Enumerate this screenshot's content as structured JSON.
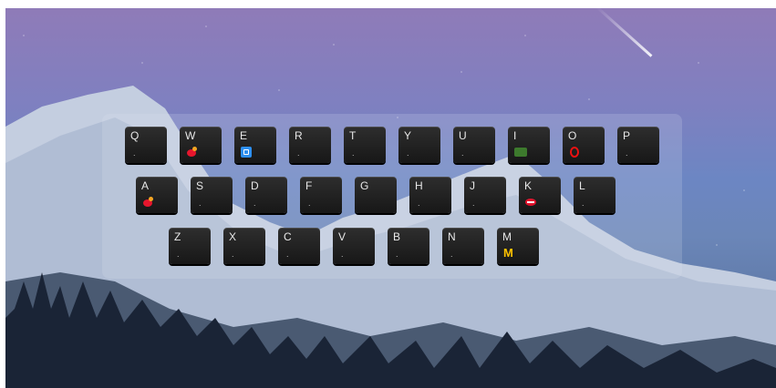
{
  "keyboard": {
    "rows": [
      [
        {
          "letter": "Q",
          "dot": ".",
          "icon": ""
        },
        {
          "letter": "W",
          "dot": "",
          "icon": "weibo-icon"
        },
        {
          "letter": "E",
          "dot": "",
          "icon": "blue-app-icon"
        },
        {
          "letter": "R",
          "dot": ".",
          "icon": ""
        },
        {
          "letter": "T",
          "dot": ".",
          "icon": ""
        },
        {
          "letter": "Y",
          "dot": ".",
          "icon": ""
        },
        {
          "letter": "U",
          "dot": ".",
          "icon": ""
        },
        {
          "letter": "I",
          "dot": "",
          "icon": "iqiyi-icon"
        },
        {
          "letter": "O",
          "dot": "",
          "icon": "opera-icon"
        },
        {
          "letter": "P",
          "dot": ".",
          "icon": ""
        }
      ],
      [
        {
          "letter": "A",
          "dot": "",
          "icon": "weibo-icon"
        },
        {
          "letter": "S",
          "dot": ".",
          "icon": ""
        },
        {
          "letter": "D",
          "dot": ".",
          "icon": ""
        },
        {
          "letter": "F",
          "dot": ".",
          "icon": ""
        },
        {
          "letter": "G",
          "dot": "",
          "icon": ""
        },
        {
          "letter": "H",
          "dot": ".",
          "icon": ""
        },
        {
          "letter": "J",
          "dot": ".",
          "icon": ""
        },
        {
          "letter": "K",
          "dot": "",
          "icon": "lips-icon"
        },
        {
          "letter": "L",
          "dot": ".",
          "icon": ""
        }
      ],
      [
        {
          "letter": "Z",
          "dot": ".",
          "icon": ""
        },
        {
          "letter": "X",
          "dot": ".",
          "icon": ""
        },
        {
          "letter": "C",
          "dot": ".",
          "icon": ""
        },
        {
          "letter": "V",
          "dot": ".",
          "icon": ""
        },
        {
          "letter": "B",
          "dot": ".",
          "icon": ""
        },
        {
          "letter": "N",
          "dot": ".",
          "icon": ""
        },
        {
          "letter": "M",
          "dot": "",
          "icon": "mcdonalds-icon"
        }
      ]
    ]
  },
  "colors": {
    "key_bg": "#1f1f1f",
    "panel_bg": "rgba(230,235,245,0.18)",
    "mcdonalds_glyph": "M"
  }
}
